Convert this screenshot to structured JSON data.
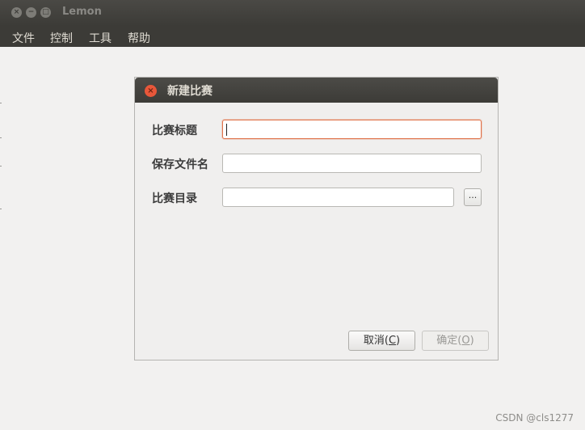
{
  "window": {
    "title": "Lemon",
    "close_glyph": "×",
    "minimize_glyph": "−",
    "maximize_glyph": "□"
  },
  "menubar": {
    "items": [
      "文件",
      "控制",
      "工具",
      "帮助"
    ]
  },
  "dialog": {
    "title": "新建比赛",
    "close_glyph": "×",
    "fields": [
      {
        "label": "比赛标题",
        "value": ""
      },
      {
        "label": "保存文件名",
        "value": ""
      },
      {
        "label": "比赛目录",
        "value": ""
      }
    ],
    "browse_label": "...",
    "cancel_text": "取消(",
    "cancel_key": "C",
    "cancel_close": ")",
    "ok_text": "确定(",
    "ok_key": "O",
    "ok_close": ")"
  },
  "watermark": "CSDN @cls1277",
  "colors": {
    "focus": "#e0724a",
    "titlebar": "#3c3b37",
    "close": "#e8573a"
  }
}
